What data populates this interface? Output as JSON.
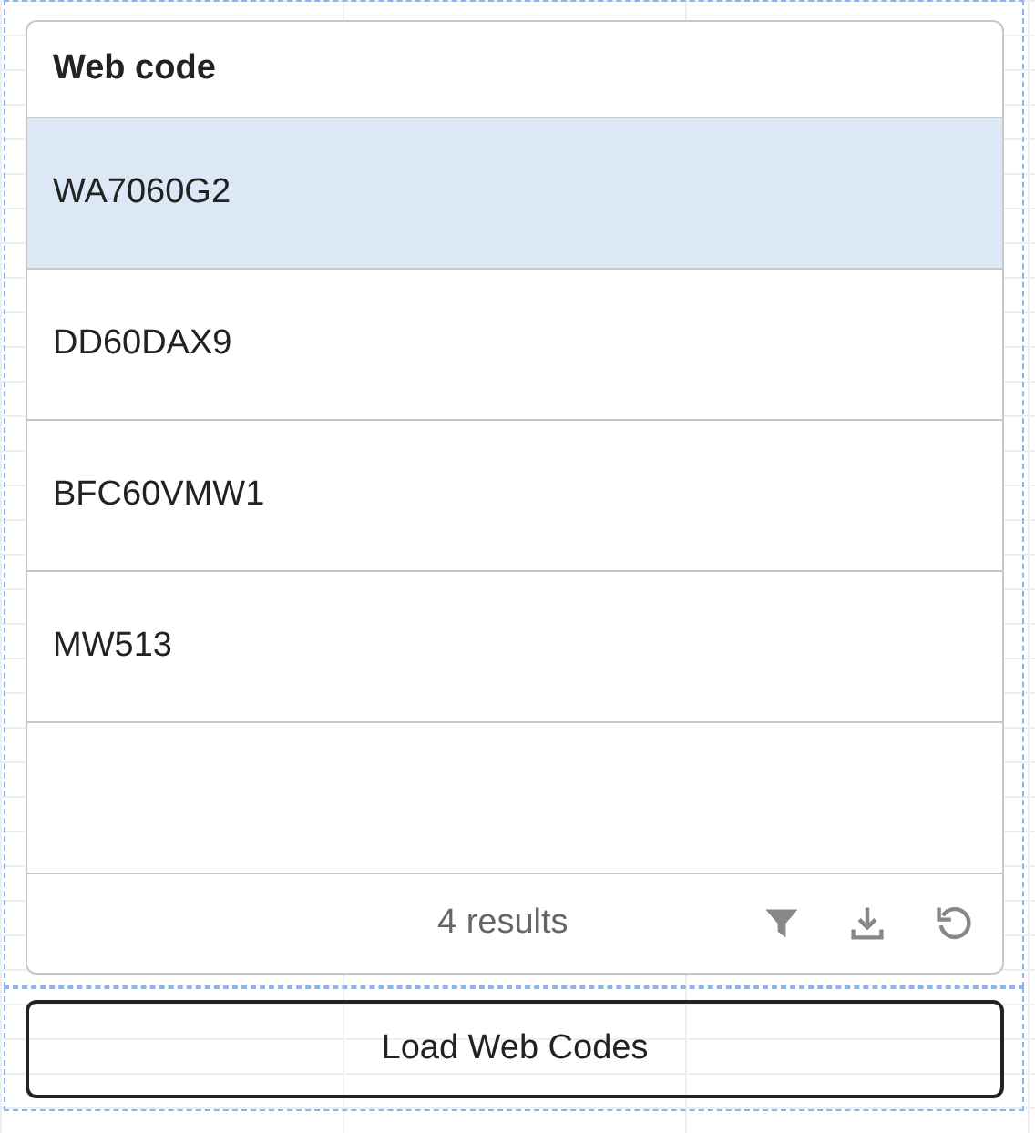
{
  "table": {
    "columns": [
      {
        "label": "Web code"
      }
    ],
    "rows": [
      {
        "web_code": "WA7060G2",
        "selected": true
      },
      {
        "web_code": "DD60DAX9",
        "selected": false
      },
      {
        "web_code": "BFC60VMW1",
        "selected": false
      },
      {
        "web_code": "MW513",
        "selected": false
      }
    ],
    "footer": {
      "result_count": "4 results"
    }
  },
  "button": {
    "label": "Load Web Codes"
  }
}
